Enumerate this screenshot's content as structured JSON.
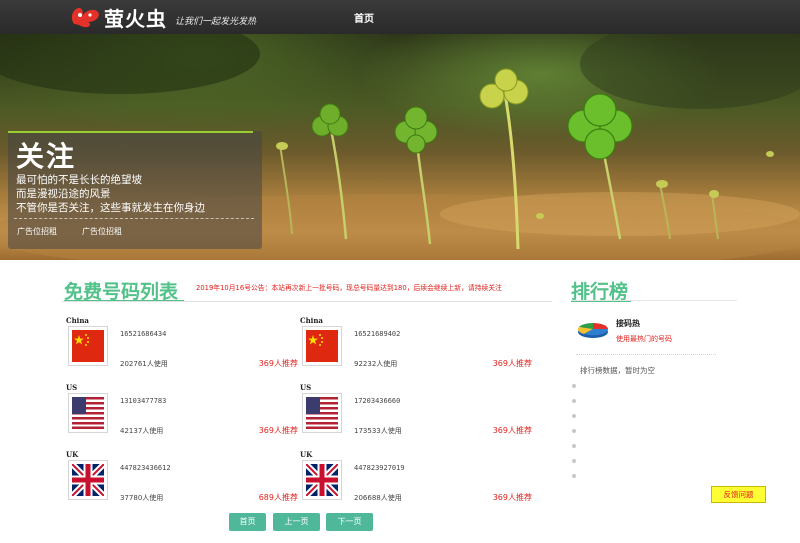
{
  "header": {
    "logo_text": "萤火虫",
    "slogan": "让我们一起发光发热",
    "nav_home": "首页"
  },
  "banner": {
    "title": "关注",
    "lines": [
      "最可怕的不是长长的绝望坡",
      "而是漫视沿途的风景",
      "不管你是否关注，这些事就发生在你身边"
    ],
    "ad_links": [
      "广告位招租",
      "广告位招租"
    ]
  },
  "main": {
    "title": "免费号码列表",
    "notice": "2019年10月16号公告：本站再次新上一批号码，现总号码量达到180，后续会继续上新，请持续关注",
    "cards": [
      {
        "country": "China",
        "flag": "china-flag",
        "number": "16521686434",
        "users": "202761人使用",
        "recommend": "369人推荐"
      },
      {
        "country": "China",
        "flag": "china-flag",
        "number": "16521689402",
        "users": "92232人使用",
        "recommend": "369人推荐"
      },
      {
        "country": "US",
        "flag": "us-flag",
        "number": "13103477783",
        "users": "42137人使用",
        "recommend": "369人推荐"
      },
      {
        "country": "US",
        "flag": "us-flag",
        "number": "17203436660",
        "users": "173533人使用",
        "recommend": "369人推荐"
      },
      {
        "country": "UK",
        "flag": "uk-flag",
        "number": "447823436612",
        "users": "37780人使用",
        "recommend": "689人推荐"
      },
      {
        "country": "UK",
        "flag": "uk-flag",
        "number": "447823927019",
        "users": "206688人使用",
        "recommend": "369人推荐"
      }
    ],
    "pagination": {
      "first": "首页",
      "prev": "上一页",
      "next": "下一页"
    }
  },
  "sidebar": {
    "title": "排行榜",
    "item_title": "接码热",
    "item_desc": "使用最热门的号码",
    "empty_text": "排行榜数据，暂时为空",
    "feedback_button": "反馈问题"
  },
  "colors": {
    "accent": "#52c28a",
    "alert": "#e0221e",
    "topbar": "#2f2f2f",
    "pager": "#4fb89a",
    "feedback_bg": "#ffff33"
  }
}
